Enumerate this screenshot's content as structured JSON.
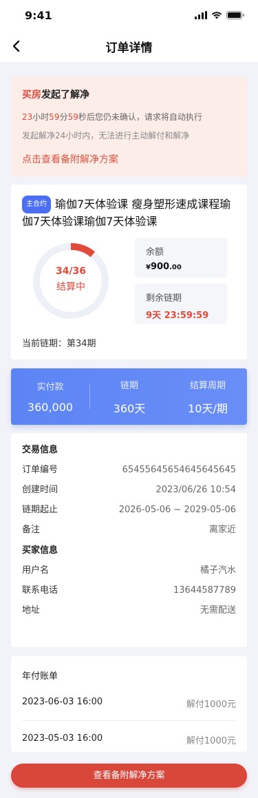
{
  "status_bar": {
    "time": "9:41"
  },
  "nav": {
    "title": "订单详情"
  },
  "alert": {
    "initiator": "买房",
    "action": "发起了解净",
    "countdown": {
      "hours": "23",
      "h_unit": "小时",
      "minutes": "59",
      "m_unit": "分",
      "seconds": "59",
      "s_suffix": "秒后您仍未确认，请求将自动执行"
    },
    "note": "发起解净24小时内，无法进行主动解付和解净",
    "link": "点击查看备附解净方案"
  },
  "product": {
    "tag": "主合约",
    "title": "瑜伽7天体验课 瘦身塑形速成课程瑜伽7天体验课瑜伽7天体验课",
    "progress": {
      "current": 34,
      "total": 36,
      "label": "34/36",
      "status": "结算中"
    },
    "balance": {
      "label": "余额",
      "currency": "¥",
      "amount": "900",
      "decimal": ".00"
    },
    "remaining": {
      "label": "剩余链期",
      "value": "9天 23:59:59"
    },
    "current_period": "当前链期：第34期"
  },
  "summary": [
    {
      "label": "实付款",
      "value": "360,000"
    },
    {
      "label": "链期",
      "value": "360天"
    },
    {
      "label": "结算周期",
      "value": "10天/期"
    }
  ],
  "trade_info": {
    "title": "交易信息",
    "rows": [
      {
        "k": "订单编号",
        "v": "65455645654645645645"
      },
      {
        "k": "创建时间",
        "v": "2023/06/26 10:54"
      },
      {
        "k": "链期起止",
        "v": "2026-05-06 ~ 2029-05-06"
      },
      {
        "k": "备注",
        "v": "离家近"
      }
    ]
  },
  "buyer_info": {
    "title": "买家信息",
    "rows": [
      {
        "k": "用户名",
        "v": "橘子汽水"
      },
      {
        "k": "联系电话",
        "v": "13644587789"
      },
      {
        "k": "地址",
        "v": "无需配送"
      }
    ]
  },
  "bill": {
    "title": "年付账单",
    "rows": [
      {
        "date": "2023-06-03 16:00",
        "amount": "解付1000元"
      },
      {
        "date": "2023-05-03 16:00",
        "amount": "解付1000元"
      }
    ]
  },
  "button": {
    "label": "查看备附解净方案"
  },
  "colors": {
    "accent_red": "#E24A3B",
    "blue": "#5C84F4",
    "tag_blue": "#4C6EF5"
  }
}
